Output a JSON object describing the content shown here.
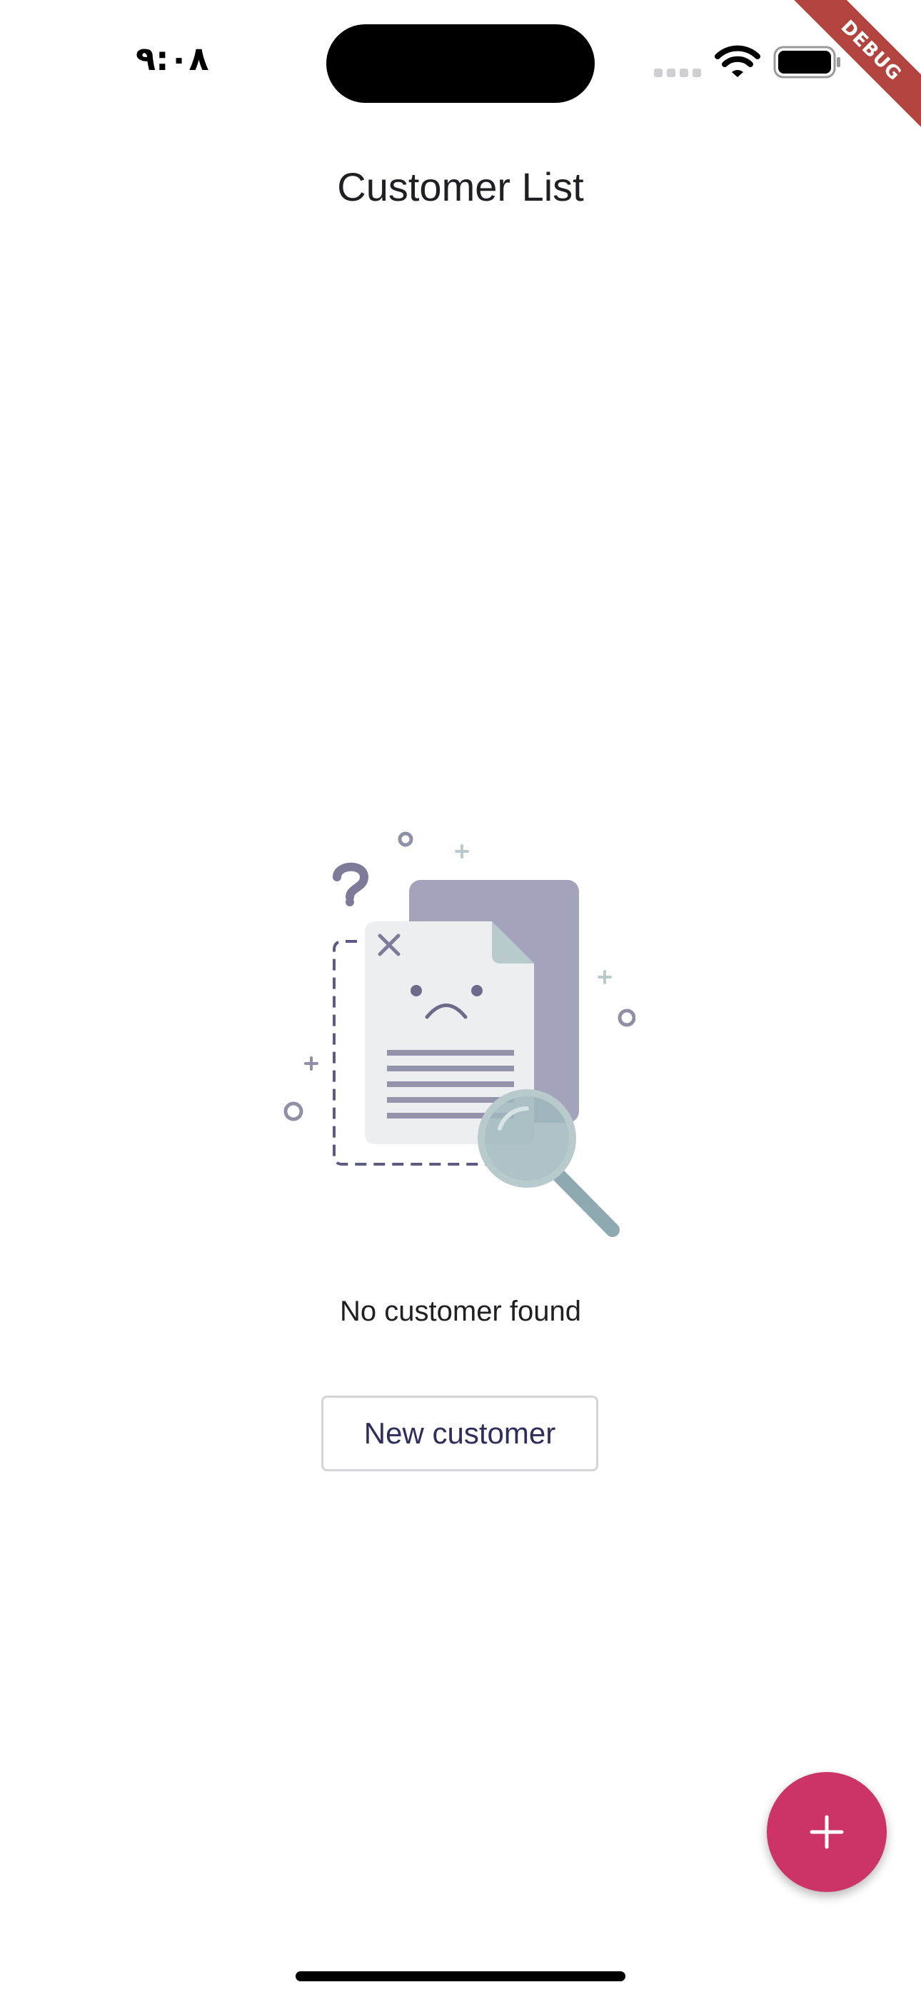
{
  "status_bar": {
    "time": "٩:٠٨",
    "icons": [
      "cellular-signal-icon",
      "wifi-icon",
      "battery-icon"
    ]
  },
  "debug_banner": {
    "label": "DEBUG",
    "color": "#b3433f"
  },
  "app_bar": {
    "title": "Customer List"
  },
  "empty_state": {
    "illustration": "document-not-found-illustration",
    "message": "No customer found",
    "button_label": "New customer"
  },
  "fab": {
    "icon": "plus-icon",
    "color": "#cc3366"
  },
  "colors": {
    "accent": "#cc3366",
    "button_text": "#2f2d5c",
    "illustration_purple": "#a3a3bb",
    "illustration_teal": "#a0b7bd"
  }
}
